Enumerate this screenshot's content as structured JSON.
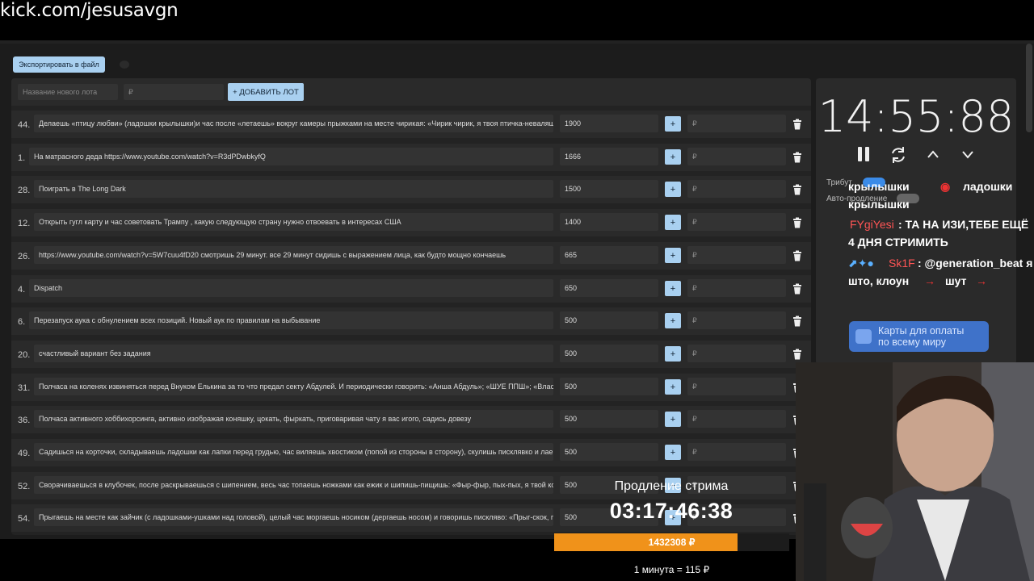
{
  "overlay_url": "kick.com/jesusavgn",
  "toolbar": {
    "export_label": "Экспортировать в файл"
  },
  "new_lot": {
    "name_placeholder": "Название нового лота",
    "amount_placeholder": "₽",
    "add_label": "+ ДОБАВИТЬ ЛОТ"
  },
  "lots": [
    {
      "num": "44.",
      "title": "Делаешь «птицу любви» (ладошки крылышки)и час после «летаешь» вокруг камеры прыжками на месте чирикая: «Чирик чирик, я твоя птичка-неваляшка",
      "amount": "1900",
      "plus": "+",
      "rub": "₽"
    },
    {
      "num": "1.",
      "title": "На матрасного деда https://www.youtube.com/watch?v=R3dPDwbkyfQ",
      "amount": "1666",
      "plus": "+",
      "rub": "₽"
    },
    {
      "num": "28.",
      "title": "Поиграть в The Long Dark",
      "amount": "1500",
      "plus": "+",
      "rub": "₽"
    },
    {
      "num": "12.",
      "title": "Открыть гугл карту и час советовать Трампу , какую следующую страну нужно отвоевать в интересах США",
      "amount": "1400",
      "plus": "+",
      "rub": "₽"
    },
    {
      "num": "26.",
      "title": "https://www.youtube.com/watch?v=5W7cuu4fD20 смотришь 29 минут. все 29 минут сидишь с выражением лица, как будто мощно кончаешь",
      "amount": "665",
      "plus": "+",
      "rub": "₽"
    },
    {
      "num": "4.",
      "title": "Dispatch",
      "amount": "650",
      "plus": "+",
      "rub": "₽"
    },
    {
      "num": "6.",
      "title": "Перезапуск аука с обнулением всех позиций. Новый аук по правилам на выбывание",
      "amount": "500",
      "plus": "+",
      "rub": "₽"
    },
    {
      "num": "20.",
      "title": "счастливый вариант без задания",
      "amount": "500",
      "plus": "+",
      "rub": "₽"
    },
    {
      "num": "31.",
      "title": "Полчаса на коленях извиняться перед Внуком Елькина за то что предал секту Абдулей. И периодически говорить: «Анша Абдуль»; «ШУЕ ППШ»; «Властелин",
      "amount": "500",
      "plus": "+",
      "rub": "₽"
    },
    {
      "num": "36.",
      "title": "Полчаса активного хоббихорсинга, активно изображая коняшку, цокать, фыркать, приговаривая чату я вас игого, садись довезу",
      "amount": "500",
      "plus": "+",
      "rub": "₽"
    },
    {
      "num": "49.",
      "title": "Садишься на корточки, складываешь ладошки как лапки перед грудью, час виляешь хвостиком (попой из стороны в сторону), скулишь писклявко и лаешь",
      "amount": "500",
      "plus": "+",
      "rub": "₽"
    },
    {
      "num": "52.",
      "title": "Сворачиваешься в клубочек, после раскрываешься с шипением, весь час топаешь ножками как ежик и шипишь-пищишь: «Фыр-фыр, пых-пых, я твой колючий",
      "amount": "500",
      "plus": "+",
      "rub": "₽"
    },
    {
      "num": "54.",
      "title": "Прыгаешь на месте как зайчик (с ладошками-ушками над головой), целый час моргаешь носиком (дергаешь носом) и говоришь писклявo: «Прыг-скок, прыг-скок",
      "amount": "500",
      "plus": "+",
      "rub": "₽"
    }
  ],
  "timer": {
    "value": "14:55:88",
    "tribute_label": "Трибут",
    "auto_label": "Авто-продление"
  },
  "chat": {
    "line0": "крылышки",
    "line0b": "ладошки",
    "line1": "крылышки",
    "user1": "FYgiYesi",
    "msg1a": ": ТА НА ИЗИ,ТЕБЕ ЕЩЁ",
    "msg1b": "4 ДНЯ СТРИМИТЬ",
    "user2": "Sk1F",
    "msg2a": ": @generation_beat я",
    "msg2b": "што, клоун",
    "msg2c": "шут"
  },
  "card_badge": {
    "line1": "Карты для оплаты",
    "line2": "по всему миру"
  },
  "stream_extension": {
    "label": "Продление стрима",
    "time": "03:17:46:38",
    "amount": "1432308 ₽",
    "progress": 0.78,
    "rate": "1 минута = 115 ₽"
  },
  "colors": {
    "accent": "#a9d0f0",
    "progress": "#f0921a",
    "toggle_on": "#3b8be8"
  }
}
